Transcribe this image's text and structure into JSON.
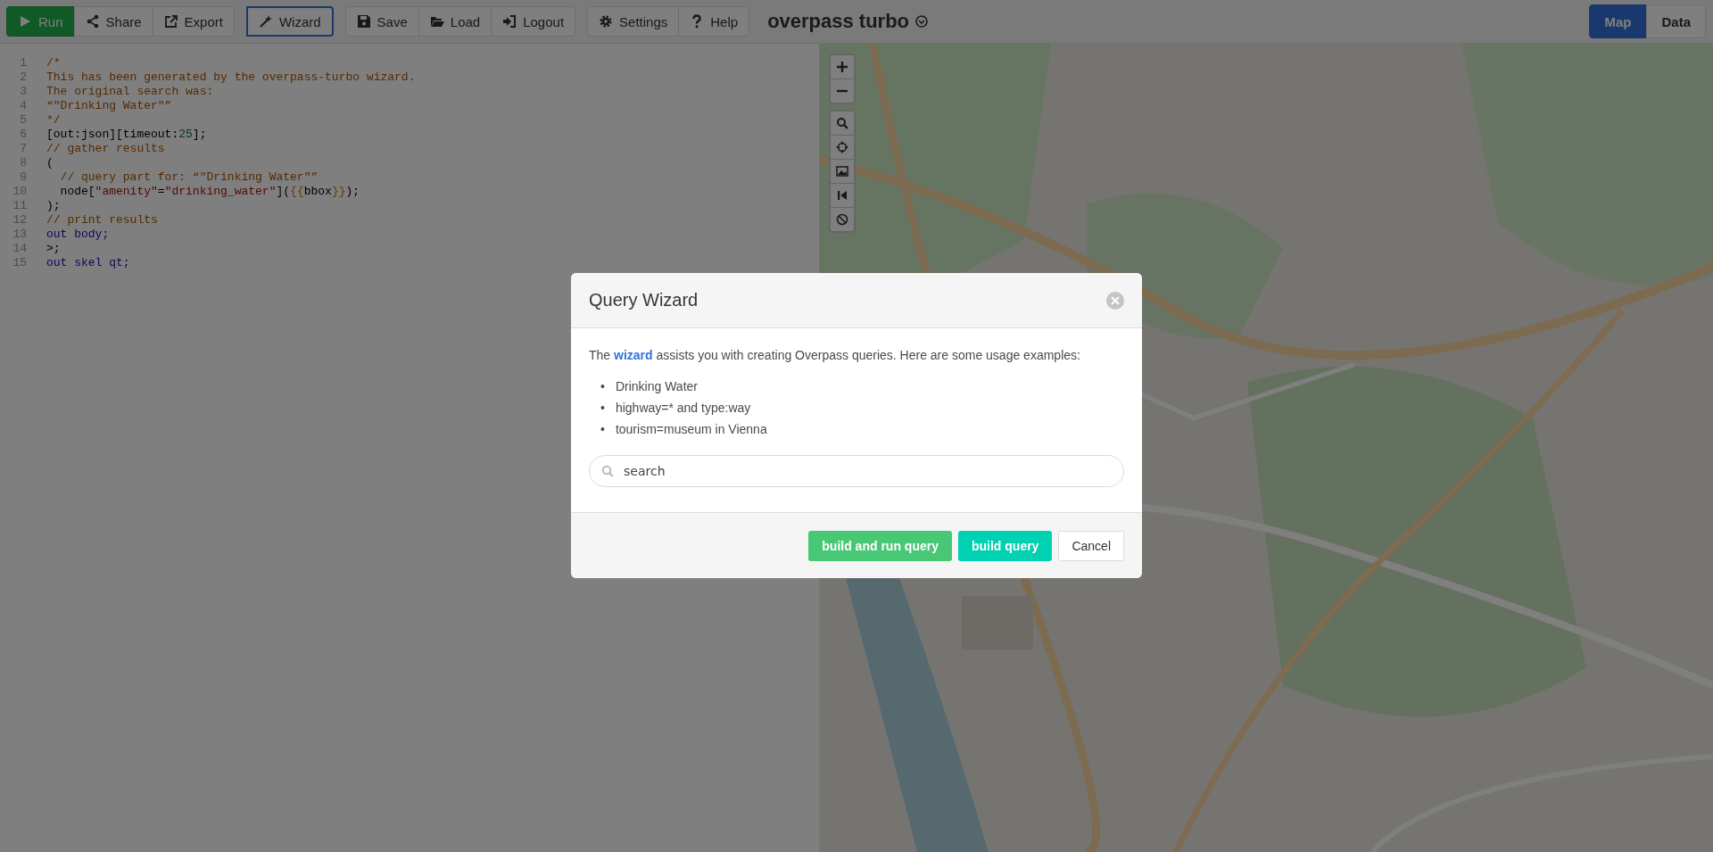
{
  "toolbar": {
    "groups": [
      {
        "buttons": [
          {
            "label": "Run",
            "kind": "primary",
            "selected": false
          },
          {
            "label": "Share",
            "kind": "default",
            "selected": false
          },
          {
            "label": "Export",
            "kind": "default",
            "selected": false
          }
        ]
      },
      {
        "buttons": [
          {
            "label": "Wizard",
            "kind": "default",
            "selected": true
          }
        ]
      },
      {
        "buttons": [
          {
            "label": "Save",
            "kind": "default",
            "selected": false
          },
          {
            "label": "Load",
            "kind": "default",
            "selected": false
          },
          {
            "label": "Logout",
            "kind": "default",
            "selected": false
          }
        ]
      },
      {
        "buttons": [
          {
            "label": "Settings",
            "kind": "default",
            "selected": false
          },
          {
            "label": "Help",
            "kind": "default",
            "selected": false
          }
        ]
      }
    ],
    "app_title": "overpass turbo",
    "view_tabs": [
      {
        "label": "Map",
        "selected": true
      },
      {
        "label": "Data",
        "selected": false
      }
    ]
  },
  "editor": {
    "lines": [
      {
        "number": "1",
        "tokens": [
          {
            "text": "/*",
            "kind": "comment"
          }
        ]
      },
      {
        "number": "2",
        "tokens": [
          {
            "text": "This has been generated by the overpass-turbo wizard.",
            "kind": "comment"
          }
        ]
      },
      {
        "number": "3",
        "tokens": [
          {
            "text": "The original search was:",
            "kind": "comment"
          }
        ]
      },
      {
        "number": "4",
        "tokens": [
          {
            "text": "“\"Drinking Water\"”",
            "kind": "comment"
          }
        ]
      },
      {
        "number": "5",
        "tokens": [
          {
            "text": "*/",
            "kind": "comment"
          }
        ]
      },
      {
        "number": "6",
        "tokens": [
          {
            "text": "[out:json][timeout:",
            "kind": "plain"
          },
          {
            "text": "25",
            "kind": "number"
          },
          {
            "text": "];",
            "kind": "plain"
          }
        ]
      },
      {
        "number": "7",
        "tokens": [
          {
            "text": "// gather results",
            "kind": "comment"
          }
        ]
      },
      {
        "number": "8",
        "tokens": [
          {
            "text": "(",
            "kind": "plain"
          }
        ]
      },
      {
        "number": "9",
        "tokens": [
          {
            "text": "  // query part for: “\"Drinking Water\"”",
            "kind": "comment"
          }
        ]
      },
      {
        "number": "10",
        "tokens": [
          {
            "text": "  node[",
            "kind": "plain"
          },
          {
            "text": "\"amenity\"",
            "kind": "string"
          },
          {
            "text": "=",
            "kind": "plain"
          },
          {
            "text": "\"drinking_water\"",
            "kind": "string"
          },
          {
            "text": "](",
            "kind": "plain"
          },
          {
            "text": "{{",
            "kind": "shortcut"
          },
          {
            "text": "bbox",
            "kind": "plain"
          },
          {
            "text": "}}",
            "kind": "shortcut"
          },
          {
            "text": ");",
            "kind": "plain"
          }
        ]
      },
      {
        "number": "11",
        "tokens": [
          {
            "text": ");",
            "kind": "plain"
          }
        ]
      },
      {
        "number": "12",
        "tokens": [
          {
            "text": "// print results",
            "kind": "comment"
          }
        ]
      },
      {
        "number": "13",
        "tokens": [
          {
            "text": "out body;",
            "kind": "keyword"
          }
        ]
      },
      {
        "number": "14",
        "tokens": [
          {
            "text": ">;",
            "kind": "plain"
          }
        ]
      },
      {
        "number": "15",
        "tokens": [
          {
            "text": "out skel qt;",
            "kind": "keyword"
          }
        ]
      }
    ]
  },
  "dialog": {
    "title": "Query Wizard",
    "intro": {
      "before": "The ",
      "link": "wizard",
      "after": " assists you with creating Overpass queries. Here are some usage examples:"
    },
    "examples": [
      {
        "marker": "•",
        "text": "Drinking Water"
      },
      {
        "marker": "•",
        "text": "highway=* and type:way"
      },
      {
        "marker": "•",
        "text": "tourism=museum in Vienna"
      }
    ],
    "search": {
      "placeholder": "search"
    },
    "buttons": [
      {
        "label": "build and run query",
        "kind": "success"
      },
      {
        "label": "build query",
        "kind": "info"
      },
      {
        "label": "Cancel",
        "kind": "default"
      }
    ]
  }
}
